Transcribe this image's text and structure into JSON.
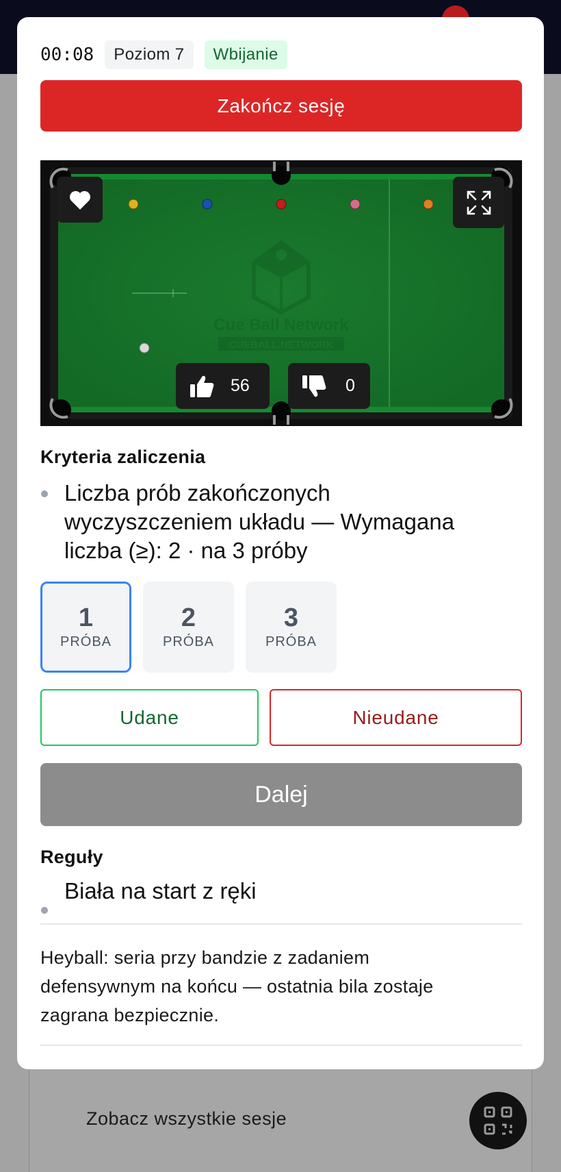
{
  "background": {
    "notification_count": "",
    "all_sessions_link": "Zobacz wszystkie sesje"
  },
  "session": {
    "timer": "00:08",
    "level": "Poziom 7",
    "type": "Wbijanie",
    "end_label": "Zakończ sesję"
  },
  "drill": {
    "watermark_title": "Cue Ball Network",
    "watermark_sub": "CUEBALL.NETWORK",
    "likes": "56",
    "dislikes": "0",
    "balls": [
      "yellow",
      "blue",
      "red",
      "pink",
      "orange",
      "white"
    ]
  },
  "criteria": {
    "title": "Kryteria zaliczenia",
    "items": [
      {
        "line1": "Liczba prób zakończonych",
        "line2": "wyczyszczeniem układu — Wymagana",
        "line3": "liczba (≥): 2 · na 3 próby"
      }
    ]
  },
  "attempts": [
    {
      "number": "1",
      "label": "PRÓBA",
      "selected": true
    },
    {
      "number": "2",
      "label": "PRÓBA",
      "selected": false
    },
    {
      "number": "3",
      "label": "PRÓBA",
      "selected": false
    }
  ],
  "result": {
    "success_label": "Udane",
    "fail_label": "Nieudane",
    "next_label": "Dalej"
  },
  "rules": {
    "title": "Reguły",
    "items": [
      "Biała na start z ręki"
    ]
  },
  "description": {
    "line1": "Heyball: seria przy bandzie z zadaniem",
    "line2": "defensywnym na końcu — ostatnia bila zostaje",
    "line3": "zagrana bezpiecznie."
  },
  "colors": {
    "danger": "#dc2626",
    "success": "#22c55e",
    "accent": "#3b82f6",
    "felt": "#1a7a2e"
  }
}
